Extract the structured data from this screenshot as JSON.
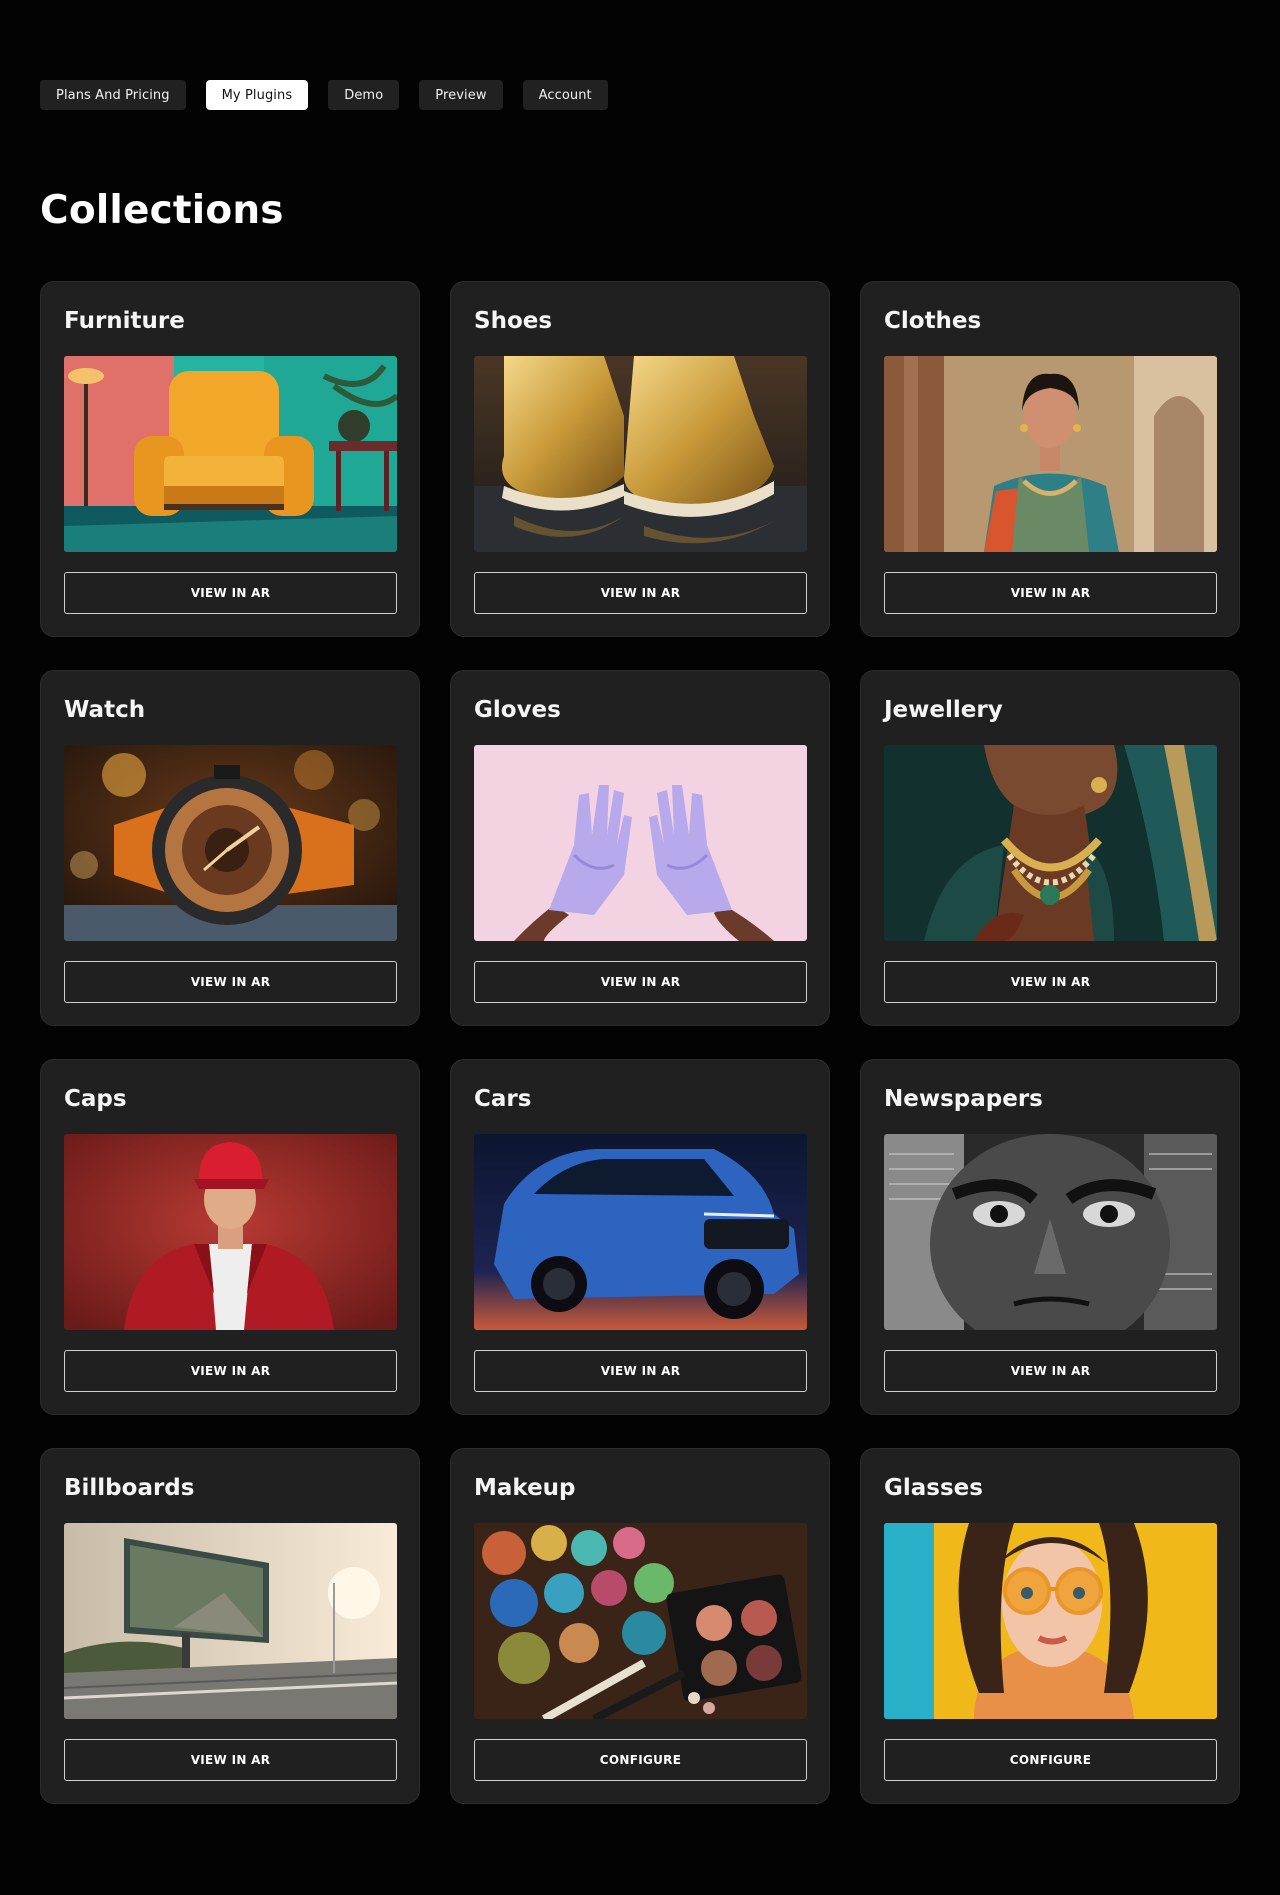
{
  "nav": {
    "tabs": [
      {
        "label": "Plans And Pricing",
        "active": false
      },
      {
        "label": "My Plugins",
        "active": true
      },
      {
        "label": "Demo",
        "active": false
      },
      {
        "label": "Preview",
        "active": false
      },
      {
        "label": "Account",
        "active": false
      }
    ]
  },
  "page_title": "Collections",
  "collections": [
    {
      "title": "Furniture",
      "image": "armchair-photo",
      "button": "VIEW IN AR"
    },
    {
      "title": "Shoes",
      "image": "gold-sneakers-photo",
      "button": "VIEW IN AR"
    },
    {
      "title": "Clothes",
      "image": "woman-in-lehenga-photo",
      "button": "VIEW IN AR"
    },
    {
      "title": "Watch",
      "image": "wristwatch-photo",
      "button": "VIEW IN AR"
    },
    {
      "title": "Gloves",
      "image": "lavender-gloves-photo",
      "button": "VIEW IN AR"
    },
    {
      "title": "Jewellery",
      "image": "necklace-jewellery-photo",
      "button": "VIEW IN AR"
    },
    {
      "title": "Caps",
      "image": "man-in-red-cap-photo",
      "button": "VIEW IN AR"
    },
    {
      "title": "Cars",
      "image": "blue-suv-photo",
      "button": "VIEW IN AR"
    },
    {
      "title": "Newspapers",
      "image": "newspaper-face-photo",
      "button": "VIEW IN AR"
    },
    {
      "title": "Billboards",
      "image": "highway-billboard-photo",
      "button": "VIEW IN AR"
    },
    {
      "title": "Makeup",
      "image": "eyeshadow-palette-photo",
      "button": "CONFIGURE"
    },
    {
      "title": "Glasses",
      "image": "woman-yellow-glasses-photo",
      "button": "CONFIGURE"
    }
  ],
  "colors": {
    "background": "#030303",
    "card": "#202020",
    "tab": "#212121",
    "tab_active": "#ffffff",
    "button_border": "#cfcfcf"
  }
}
